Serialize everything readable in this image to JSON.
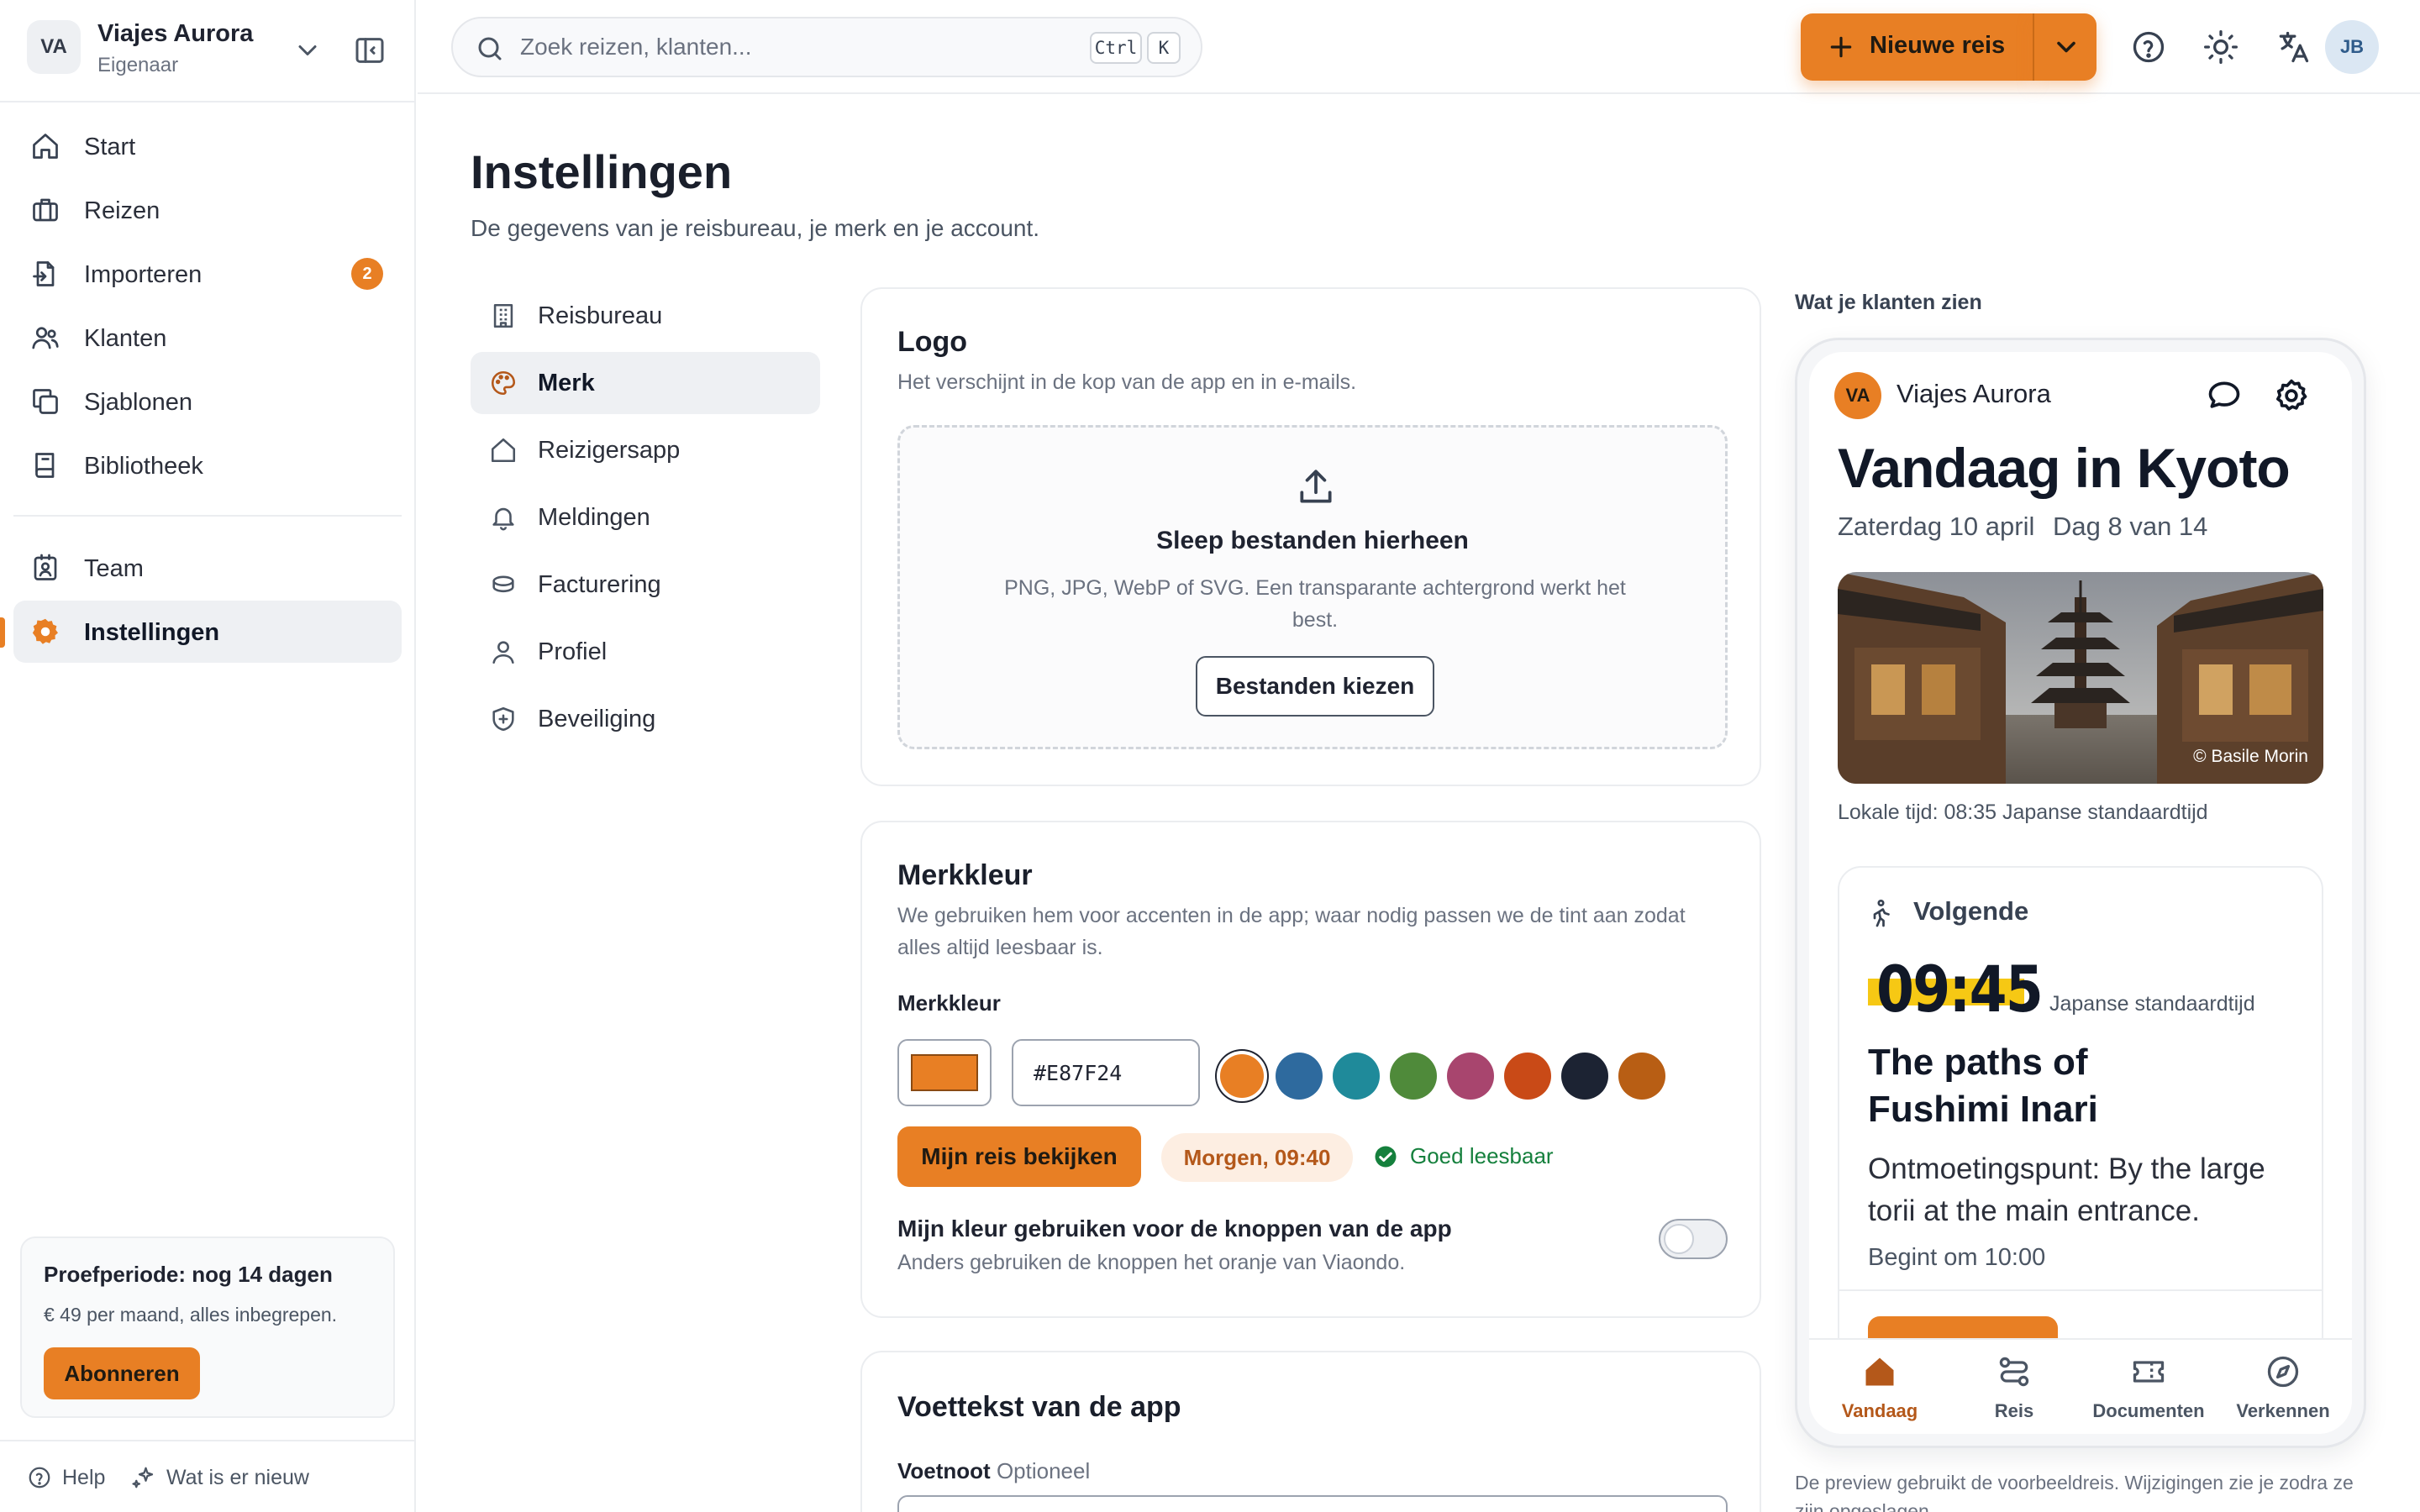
{
  "workspace": {
    "initials": "VA",
    "name": "Viajes Aurora",
    "role": "Eigenaar"
  },
  "sidebar": {
    "items": [
      {
        "label": "Start"
      },
      {
        "label": "Reizen"
      },
      {
        "label": "Importeren",
        "badge": "2"
      },
      {
        "label": "Klanten"
      },
      {
        "label": "Sjablonen"
      },
      {
        "label": "Bibliotheek"
      },
      {
        "label": "Team"
      },
      {
        "label": "Instellingen",
        "active": true
      }
    ],
    "trial": {
      "title": "Proefperiode: nog 14 dagen",
      "subtitle": "€ 49 per maand, alles inbegrepen.",
      "button": "Abonneren"
    },
    "footer": {
      "help": "Help",
      "whats_new": "Wat is er nieuw"
    }
  },
  "topbar": {
    "search_placeholder": "Zoek reizen, klanten...",
    "kbd": [
      "Ctrl",
      "K"
    ],
    "new_trip": "Nieuwe reis",
    "user_initials": "JB"
  },
  "page": {
    "title": "Instellingen",
    "subtitle": "De gegevens van je reisbureau, je merk en je account."
  },
  "settings_nav": [
    {
      "label": "Reisbureau"
    },
    {
      "label": "Merk",
      "active": true
    },
    {
      "label": "Reizigersapp"
    },
    {
      "label": "Meldingen"
    },
    {
      "label": "Facturering"
    },
    {
      "label": "Profiel"
    },
    {
      "label": "Beveiliging"
    }
  ],
  "logo_card": {
    "title": "Logo",
    "subtitle": "Het verschijnt in de kop van de app en in e-mails.",
    "drop_title": "Sleep bestanden hierheen",
    "drop_hint": "PNG, JPG, WebP of SVG. Een transparante achtergrond werkt het best.",
    "choose_button": "Bestanden kiezen"
  },
  "brand_card": {
    "title": "Merkkleur",
    "subtitle": "We gebruiken hem voor accenten in de app; waar nodig passen we de tint aan zodat alles altijd leesbaar is.",
    "field_label": "Merkkleur",
    "hex_value": "#E87F24",
    "swatches": [
      "#e87f24",
      "#2e6a9e",
      "#1f8a9a",
      "#4f8a3a",
      "#a8456e",
      "#c94a17",
      "#1c2333",
      "#b85e14"
    ],
    "preview_button": "Mijn reis bekijken",
    "preview_chip": "Morgen, 09:40",
    "contrast_status": "Goed leesbaar",
    "toggle_title": "Mijn kleur gebruiken voor de knoppen van de app",
    "toggle_subtitle": "Anders gebruiken de knoppen het oranje van Viaondo.",
    "toggle_on": false
  },
  "footer_card": {
    "title": "Voettekst van de app",
    "field_label": "Voetnoot",
    "field_optional": "Optioneel"
  },
  "preview": {
    "label": "Wat je klanten zien",
    "agency_initials": "VA",
    "agency_name": "Viajes Aurora",
    "title": "Vandaag in Kyoto",
    "date": "Zaterdag 10 april",
    "day": "Dag 8 van 14",
    "photo_credit": "© Basile Morin",
    "local_time": "Lokale tijd: 08:35 Japanse standaardtijd",
    "next_label": "Volgende",
    "next_time": "09:45",
    "next_tz": "Japanse standaardtijd",
    "next_title": "The paths of Fushimi Inari",
    "next_meeting": "Ontmoetingspunt: By the large torii at the main entrance.",
    "next_start": "Begint om 10:00",
    "tabs": [
      {
        "label": "Vandaag",
        "active": true
      },
      {
        "label": "Reis"
      },
      {
        "label": "Documenten"
      },
      {
        "label": "Verkennen"
      }
    ],
    "note": "De preview gebruikt de voorbeeldreis. Wijzigingen zie je zodra ze zijn opgeslagen."
  },
  "colors": {
    "accent": "#e87f24",
    "success": "#15803d",
    "highlight": "#f6c814"
  }
}
